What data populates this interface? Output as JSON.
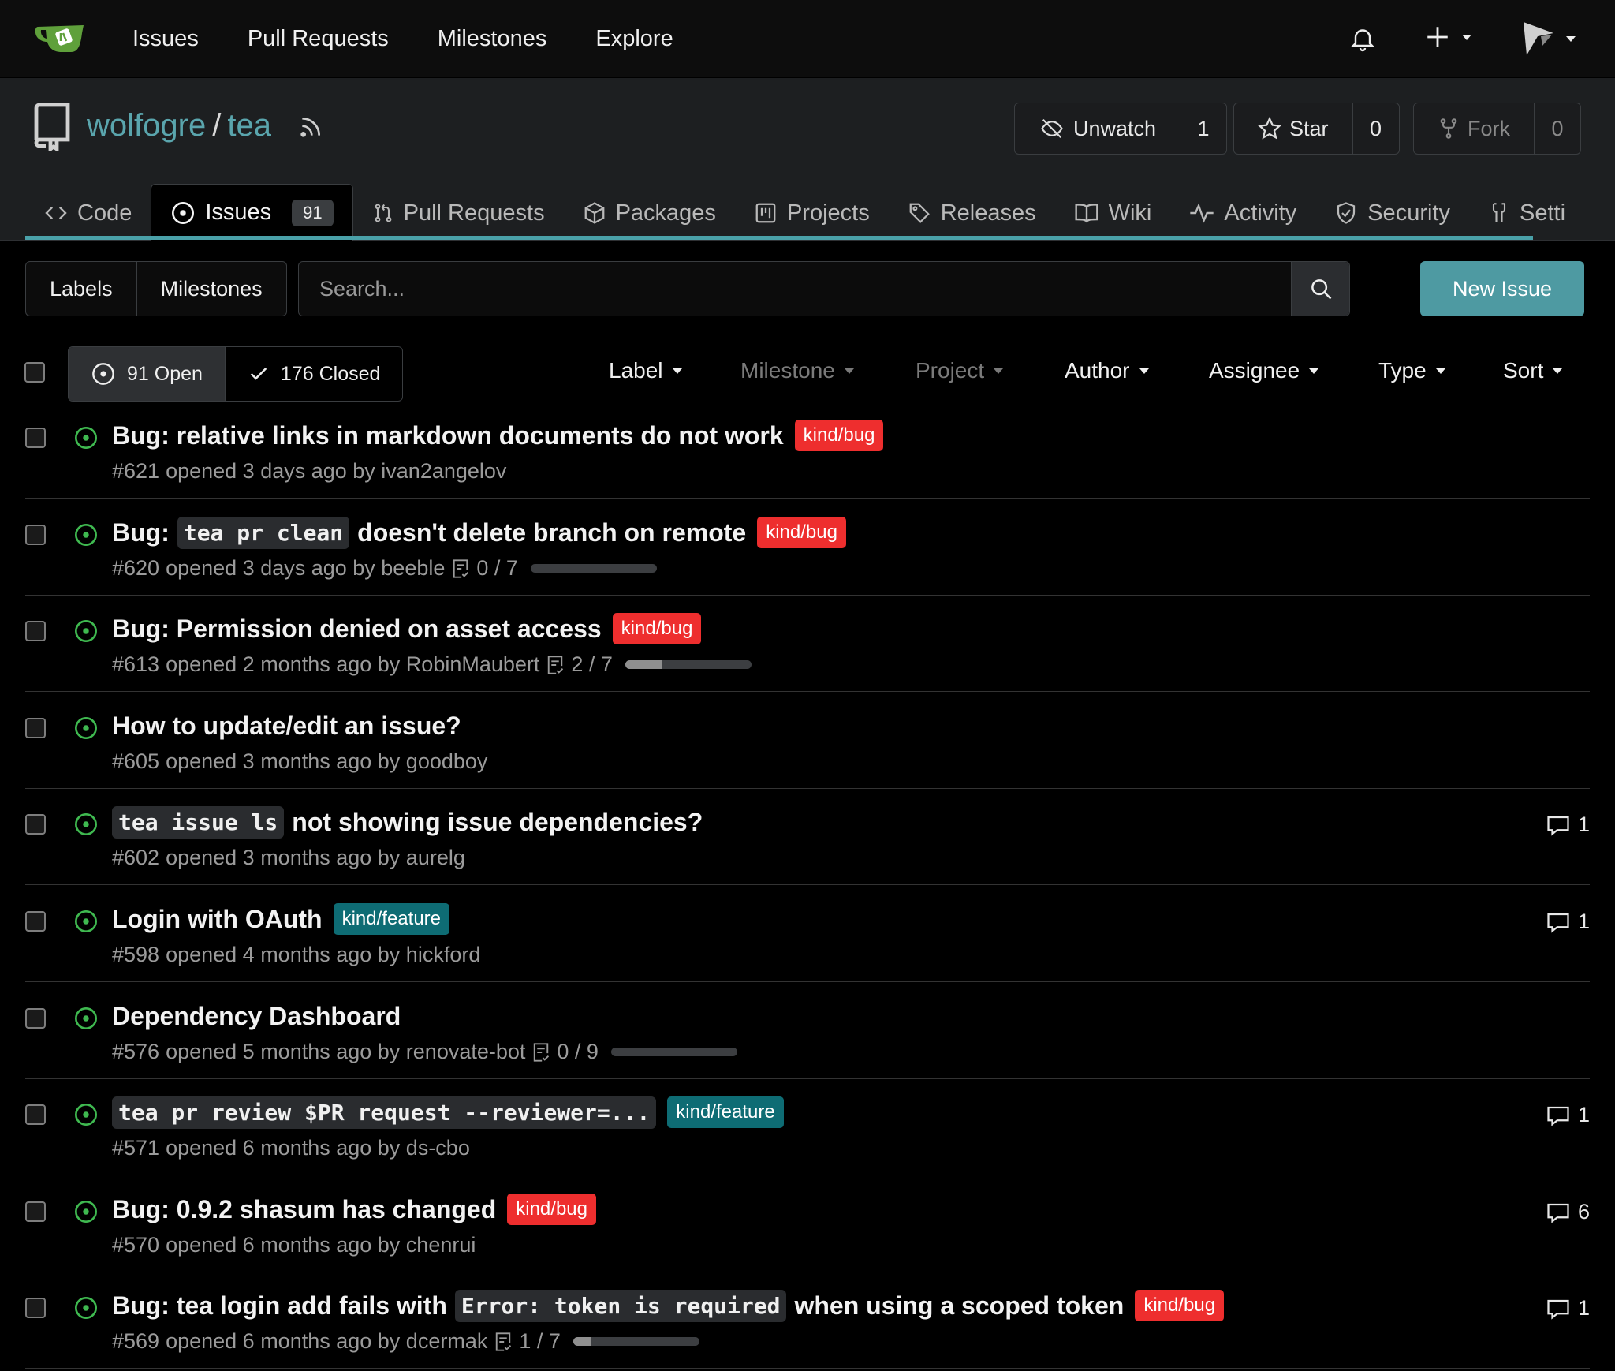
{
  "nav": {
    "links": [
      "Issues",
      "Pull Requests",
      "Milestones",
      "Explore"
    ],
    "logo_icon": "gitea-tea-cup-icon",
    "accent": "#5aa5ad"
  },
  "repo": {
    "owner": "wolfogre",
    "separator": "/",
    "name": "tea",
    "watch": {
      "label": "Unwatch",
      "count": "1"
    },
    "star": {
      "label": "Star",
      "count": "0"
    },
    "fork": {
      "label": "Fork",
      "count": "0"
    }
  },
  "tabs": [
    {
      "label": "Code",
      "icon": "code-icon"
    },
    {
      "label": "Issues",
      "icon": "issue-opened-icon",
      "badge": "91"
    },
    {
      "label": "Pull Requests",
      "icon": "git-pull-request-icon"
    },
    {
      "label": "Packages",
      "icon": "package-icon"
    },
    {
      "label": "Projects",
      "icon": "project-icon"
    },
    {
      "label": "Releases",
      "icon": "tag-icon"
    },
    {
      "label": "Wiki",
      "icon": "book-icon"
    },
    {
      "label": "Activity",
      "icon": "pulse-icon"
    },
    {
      "label": "Security",
      "icon": "shield-icon"
    },
    {
      "label": "Setti",
      "icon": "tools-icon"
    }
  ],
  "toolbar": {
    "labels": "Labels",
    "milestones": "Milestones",
    "search_placeholder": "Search...",
    "new_issue": "New Issue"
  },
  "state": {
    "open": "91 Open",
    "closed": "176 Closed"
  },
  "filters": [
    "Label",
    "Milestone",
    "Project",
    "Author",
    "Assignee",
    "Type",
    "Sort"
  ],
  "colors": {
    "bug": "#ee2e2e",
    "feature": "#0e6c74",
    "open": "#3fb950"
  },
  "issues": [
    {
      "title": [
        "Bug: relative links in markdown documents do not work"
      ],
      "label": "kind/bug",
      "number": "#621",
      "meta": "opened 3 days ago by ivan2angelov"
    },
    {
      "title": [
        "Bug: ",
        {
          "code": "tea pr clean"
        },
        " doesn't delete branch on remote"
      ],
      "label": "kind/bug",
      "number": "#620",
      "meta": "opened 3 days ago by beeble",
      "tasks": "0 / 7",
      "progress": 0
    },
    {
      "title": [
        "Bug: Permission denied on asset access"
      ],
      "label": "kind/bug",
      "number": "#613",
      "meta": "opened 2 months ago by RobinMaubert",
      "tasks": "2 / 7",
      "progress": 0.286
    },
    {
      "title": [
        "How to update/edit an issue?"
      ],
      "number": "#605",
      "meta": "opened 3 months ago by goodboy"
    },
    {
      "title": [
        {
          "code": "tea issue ls"
        },
        " not showing issue dependencies?"
      ],
      "number": "#602",
      "meta": "opened 3 months ago by aurelg",
      "comments": "1"
    },
    {
      "title": [
        "Login with OAuth"
      ],
      "label": "kind/feature",
      "number": "#598",
      "meta": "opened 4 months ago by hickford",
      "comments": "1"
    },
    {
      "title": [
        "Dependency Dashboard"
      ],
      "number": "#576",
      "meta": "opened 5 months ago by renovate-bot",
      "tasks": "0 / 9",
      "progress": 0
    },
    {
      "title": [
        {
          "code": "tea pr review $PR request --reviewer=..."
        }
      ],
      "label": "kind/feature",
      "number": "#571",
      "meta": "opened 6 months ago by ds-cbo",
      "comments": "1"
    },
    {
      "title": [
        "Bug: 0.9.2 shasum has changed"
      ],
      "label": "kind/bug",
      "number": "#570",
      "meta": "opened 6 months ago by chenrui",
      "comments": "6"
    },
    {
      "title": [
        "Bug: tea login add fails with ",
        {
          "code": "Error: token is required"
        },
        " when using a scoped token"
      ],
      "label": "kind/bug",
      "number": "#569",
      "meta": "opened 6 months ago by dcermak",
      "tasks": "1 / 7",
      "progress": 0.143,
      "comments": "1"
    }
  ]
}
